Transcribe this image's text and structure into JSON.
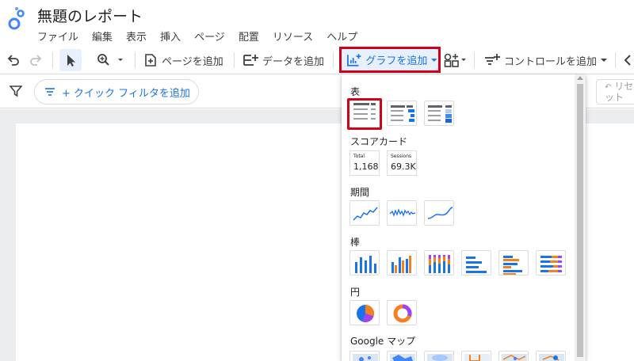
{
  "app": {
    "title": "無題のレポート",
    "menu": [
      "ファイル",
      "編集",
      "表示",
      "挿入",
      "ページ",
      "配置",
      "リソース",
      "ヘルプ"
    ]
  },
  "toolbar": {
    "add_page_label": "ページを追加",
    "add_data_label": "データを追加",
    "add_chart_label": "グラフを追加",
    "add_control_label": "コントロールを追加"
  },
  "filterbar": {
    "quick_filter_label": "+ クイック フィルタを追加",
    "reset_label": "リセット"
  },
  "chart_menu": {
    "sections": {
      "table": "表",
      "scorecard": "スコアカード",
      "timeseries": "期間",
      "bar": "棒",
      "pie": "円",
      "geo": "Google マップ"
    },
    "scorecards": [
      {
        "label": "Total",
        "value": "1,168"
      },
      {
        "label": "Sessions",
        "value": "69.3K"
      }
    ]
  },
  "colors": {
    "accent": "#1a73e8",
    "highlight": "#d0021b",
    "orange": "#f4811f",
    "purple": "#a142f4"
  }
}
